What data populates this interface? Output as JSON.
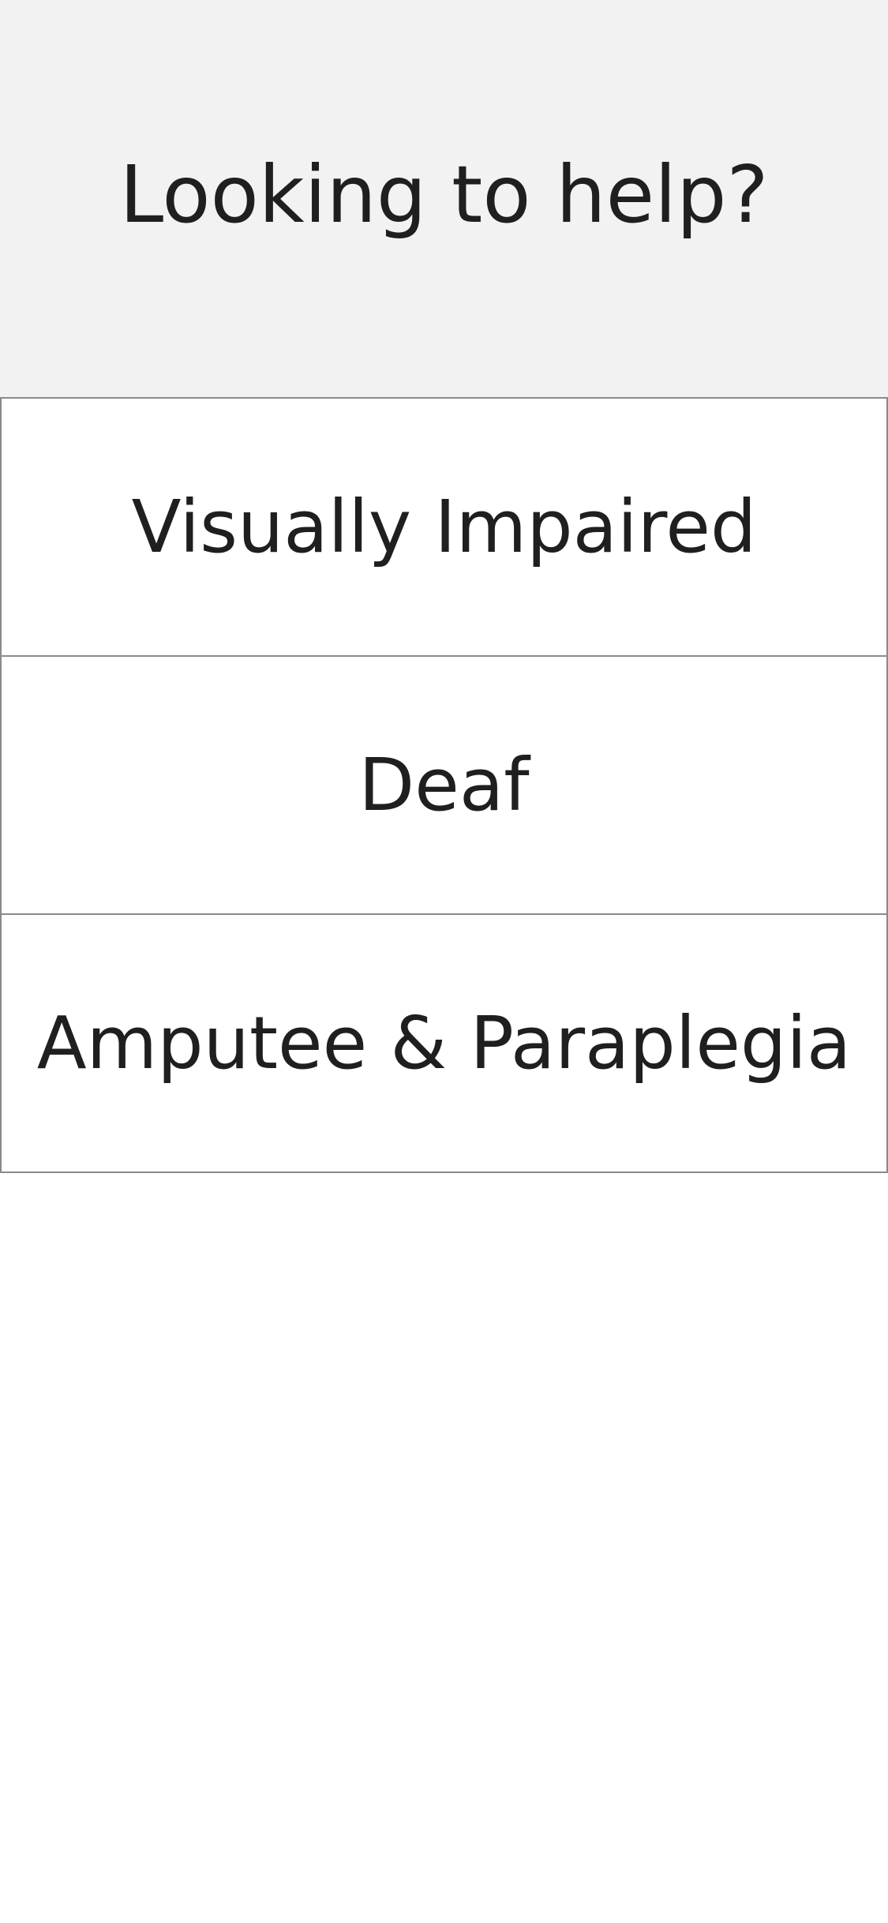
{
  "header": {
    "title": "Looking to help?",
    "background_color": "#f2f2f2"
  },
  "options": [
    {
      "label": "Visually Impaired"
    },
    {
      "label": "Deaf"
    },
    {
      "label": "Amputee & Paraplegia"
    }
  ],
  "colors": {
    "text": "#1f1f1f",
    "border": "#8a8a8a",
    "background": "#ffffff"
  }
}
